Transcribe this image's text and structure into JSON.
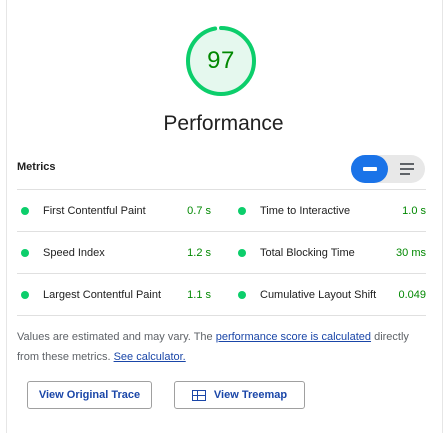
{
  "score": {
    "value": "97",
    "title": "Performance"
  },
  "metrics_heading": "Metrics",
  "metrics": [
    {
      "label": "First Contentful Paint",
      "value": "0.7 s"
    },
    {
      "label": "Time to Interactive",
      "value": "1.0 s"
    },
    {
      "label": "Speed Index",
      "value": "1.2 s"
    },
    {
      "label": "Total Blocking Time",
      "value": "30 ms"
    },
    {
      "label": "Largest Contentful Paint",
      "value": "1.1 s"
    },
    {
      "label": "Cumulative Layout Shift",
      "value": "0.049"
    }
  ],
  "note": {
    "text_before": "Values are estimated and may vary. The ",
    "link1": "performance score is calculated",
    "text_mid": " directly from these metrics. ",
    "link2": "See calculator."
  },
  "buttons": {
    "trace": "View Original Trace",
    "treemap": "View Treemap"
  },
  "colors": {
    "pass": "#0cce6b",
    "pass_text": "#008800",
    "accent": "#1a73e8",
    "link": "#1a46a8"
  },
  "icons": {
    "toggle_compact": "compact-view-icon",
    "toggle_expanded": "expanded-view-icon",
    "treemap": "treemap-icon"
  }
}
